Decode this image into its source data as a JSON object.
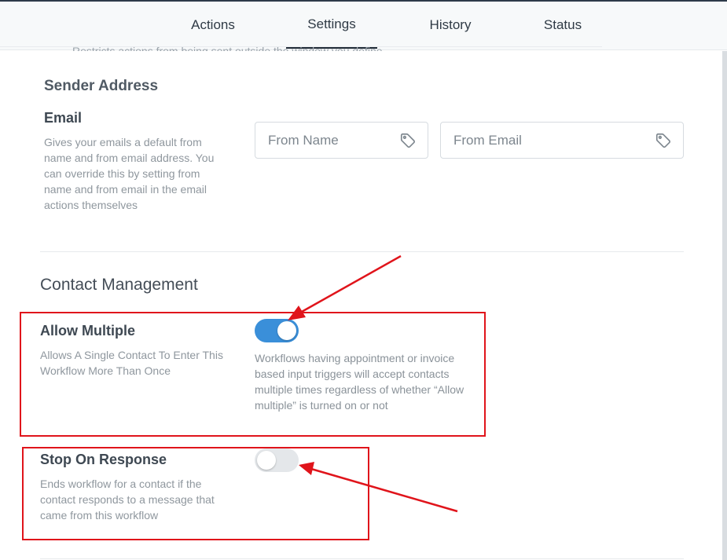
{
  "tabs": [
    {
      "label": "Actions"
    },
    {
      "label": "Settings",
      "active": true
    },
    {
      "label": "History"
    },
    {
      "label": "Status"
    }
  ],
  "cut_off_text": "Restricts actions from being sent outside the window you define.",
  "sender": {
    "section_title": "Sender Address",
    "email_label": "Email",
    "email_description": "Gives your emails a default from name and from email address. You can override this by setting from name and from email in the email actions themselves",
    "from_name_placeholder": "From Name",
    "from_email_placeholder": "From Email"
  },
  "contact_management": {
    "section_title": "Contact Management",
    "allow_multiple": {
      "label": "Allow Multiple",
      "description": "Allows A Single Contact To Enter This Workflow More Than Once",
      "note": "Workflows having appointment or invoice based input triggers will accept contacts multiple times regardless of whether “Allow multiple” is turned on or not",
      "enabled": true
    },
    "stop_on_response": {
      "label": "Stop On Response",
      "description": "Ends workflow for a contact if the contact responds to a message that came from this workflow",
      "enabled": false
    }
  },
  "colors": {
    "toggle_on": "#3a8fd9",
    "toggle_off": "#e4e7ea",
    "annotation": "#e0141b"
  },
  "icons": {
    "input_icon": "tag-icon"
  }
}
